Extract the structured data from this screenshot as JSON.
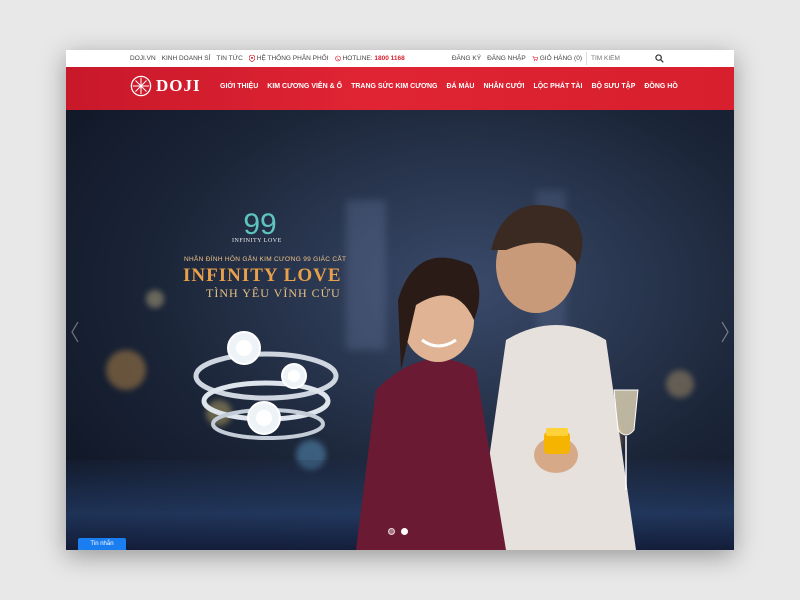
{
  "topbar": {
    "links_left": [
      "DOJI.VN",
      "KINH DOANH SỈ",
      "TIN TỨC"
    ],
    "store_link": "HỆ THỐNG PHÂN PHỐI",
    "hotline_label": "HOTLINE:",
    "hotline_number": "1800 1168",
    "register": "ĐĂNG KÝ",
    "login": "ĐĂNG NHẬP",
    "cart": "GIỎ HÀNG (0)",
    "search_placeholder": "TÌM KIẾM"
  },
  "nav": {
    "logo_text": "DOJI",
    "items": [
      "GIỚI THIỆU",
      "KIM CƯƠNG VIÊN & Ổ",
      "TRANG SỨC KIM CƯƠNG",
      "ĐÁ MÀU",
      "NHẪN CƯỚI",
      "LỘC PHÁT TÀI",
      "BỘ SƯU TẬP",
      "ĐỒNG HỒ"
    ]
  },
  "hero": {
    "badge_number": "99",
    "badge_caption": "INFINITY LOVE",
    "tagline": "NHẪN ĐÍNH HÔN GẮN KIM CƯƠNG 99 GIÁC CẮT",
    "headline": "INFINITY LOVE",
    "subheadline": "TÌNH YÊU VĨNH CỬU",
    "slide_count": 2,
    "active_slide": 2
  },
  "chat": {
    "label": "Tin nhắn"
  },
  "colors": {
    "brand_red": "#d71f2d",
    "headline_gold": "#e8a04a",
    "chat_blue": "#1a7df0"
  }
}
